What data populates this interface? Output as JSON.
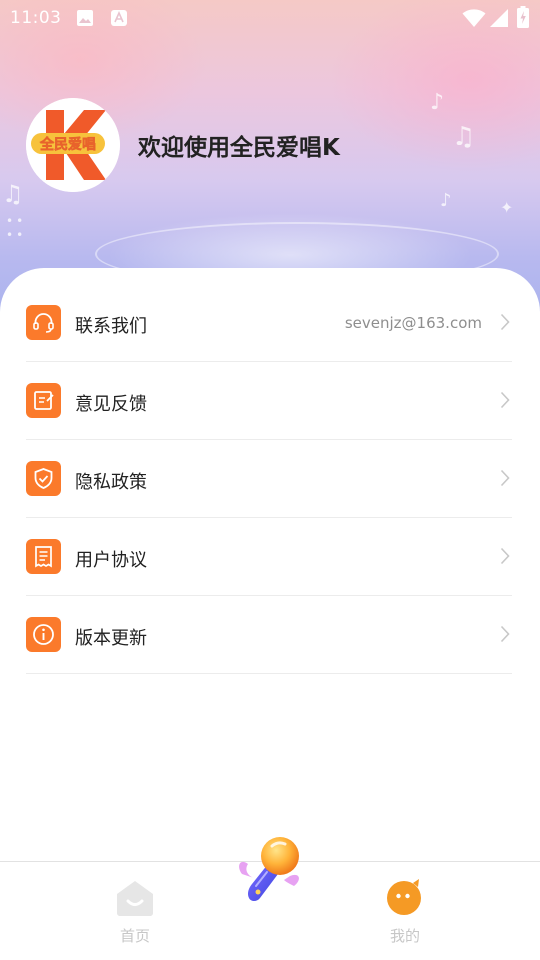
{
  "status_bar": {
    "time": "11:03"
  },
  "profile": {
    "avatar_text": "全民爱唱",
    "avatar_letter": "K",
    "welcome_text": "欢迎使用全民爱唱K"
  },
  "menu": {
    "items": [
      {
        "label": "联系我们",
        "value": "sevenjz@163.com",
        "icon": "headset-icon"
      },
      {
        "label": "意见反馈",
        "value": "",
        "icon": "edit-note-icon"
      },
      {
        "label": "隐私政策",
        "value": "",
        "icon": "shield-check-icon"
      },
      {
        "label": "用户协议",
        "value": "",
        "icon": "document-list-icon"
      },
      {
        "label": "版本更新",
        "value": "",
        "icon": "info-circle-icon"
      }
    ]
  },
  "tabbar": {
    "home_label": "首页",
    "mine_label": "我的",
    "center_icon": "microphone-icon"
  },
  "colors": {
    "accent": "#fb7a2b",
    "text_primary": "#222222",
    "text_secondary": "#8e8e8e",
    "tab_inactive": "#c7c7c7"
  }
}
